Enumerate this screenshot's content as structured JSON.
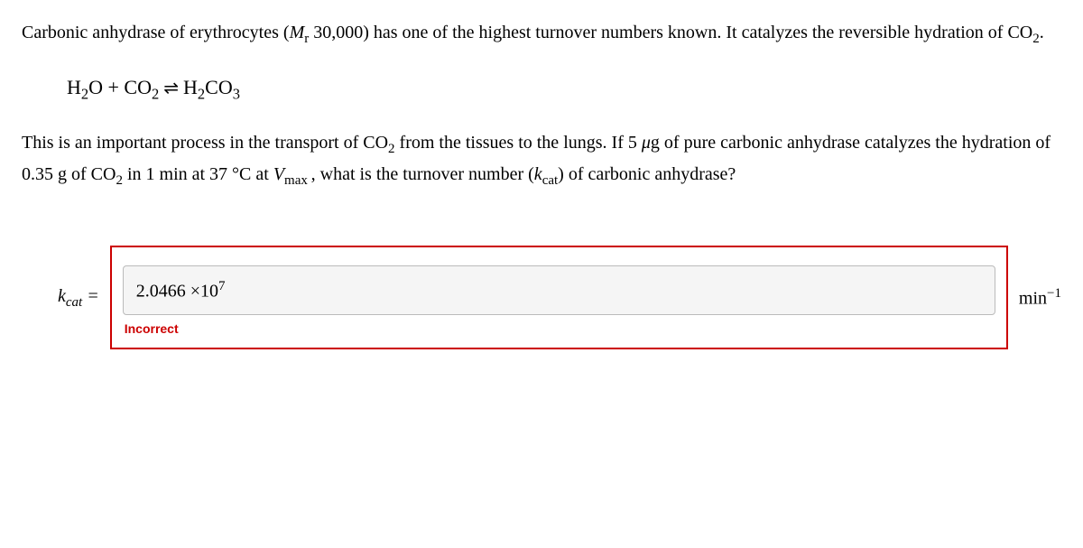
{
  "question": {
    "intro_part1": "Carbonic anhydrase of erythrocytes (",
    "mr_label": "M",
    "mr_sub": "r",
    "intro_part2": " 30,000) has one of the highest turnover numbers known. It catalyzes the reversible hydration of CO",
    "co2_sub": "2",
    "intro_end": ".",
    "equation": {
      "h2o_h": "H",
      "h2o_sub": "2",
      "h2o_o": "O + CO",
      "co2_sub": "2",
      "arrows": " ⇌ ",
      "h2co3_h": "H",
      "h2co3_sub2": "2",
      "h2co3_co": "CO",
      "h2co3_sub3": "3"
    },
    "continuation_part1": "This is an important process in the transport of CO",
    "continuation_co2_sub": "2",
    "continuation_part2": " from the tissues to the lungs. If 5 ",
    "mu": "μ",
    "continuation_part3": "g of pure carbonic anhydrase catalyzes the hydration of 0.35 g of CO",
    "continuation_co2_sub2": "2",
    "continuation_part4": " in 1 min at 37 °C at ",
    "vmax_v": "V",
    "vmax_sub": "max ",
    "continuation_part5": ", what is the turnover number (",
    "kcat_k": "k",
    "kcat_sub": "cat",
    "continuation_part6": ") of carbonic anhydrase?"
  },
  "answer": {
    "kcat_label_k": "k",
    "kcat_label_sub": "cat",
    "kcat_equals": " = ",
    "input_value_base": "2.0466 ×10",
    "input_value_exp": "7",
    "feedback": "Incorrect",
    "unit_base": "min",
    "unit_exp": "−1"
  }
}
